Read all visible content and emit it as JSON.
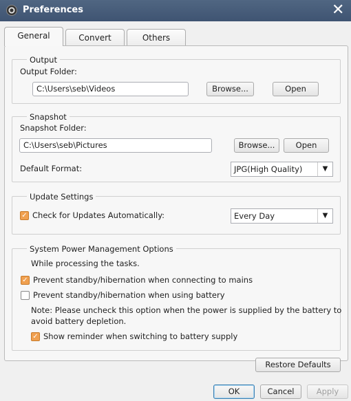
{
  "window": {
    "title": "Preferences",
    "icon": "film-reel-icon",
    "close_icon": "close-icon"
  },
  "tabs": [
    {
      "label": "General",
      "selected": true
    },
    {
      "label": "Convert",
      "selected": false
    },
    {
      "label": "Others",
      "selected": false
    }
  ],
  "output": {
    "group_label": "Output",
    "folder_label": "Output Folder:",
    "folder_value": "C:\\Users\\seb\\Videos",
    "browse": "Browse...",
    "open": "Open"
  },
  "snapshot": {
    "group_label": "Snapshot",
    "folder_label": "Snapshot Folder:",
    "folder_value": "C:\\Users\\seb\\Pictures",
    "browse": "Browse...",
    "open": "Open",
    "format_label": "Default Format:",
    "format_value": "JPG(High Quality)"
  },
  "update": {
    "group_label": "Update Settings",
    "check_label": "Check for Updates Automatically:",
    "checked": true,
    "frequency": "Every Day"
  },
  "power": {
    "group_label": "System Power Management Options",
    "intro": "While processing the tasks.",
    "mains_label": "Prevent standby/hibernation when connecting to mains",
    "mains_checked": true,
    "battery_label": "Prevent standby/hibernation when using battery",
    "battery_checked": false,
    "note_line1": "Note: Please uncheck this option when the power is supplied by the battery to",
    "note_line2": "avoid battery depletion.",
    "reminder_label": "Show reminder when switching to battery supply",
    "reminder_checked": true
  },
  "buttons": {
    "restore": "Restore Defaults",
    "ok": "OK",
    "cancel": "Cancel",
    "apply": "Apply"
  },
  "colors": {
    "titlebar": "#475b78",
    "checkbox_checked": "#f0a050"
  }
}
